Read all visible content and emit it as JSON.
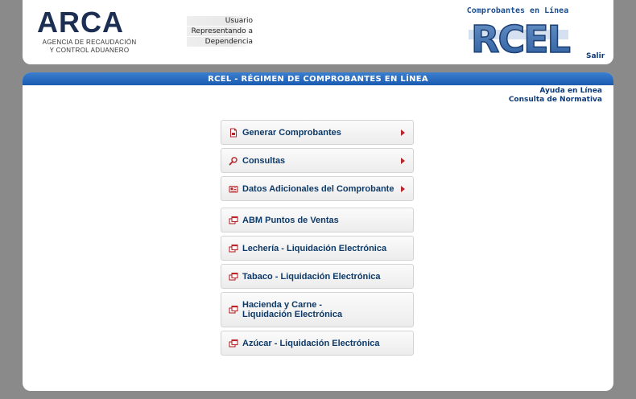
{
  "header": {
    "logo": {
      "word": "ARCA",
      "subtitle_line1": "AGENCIA DE RECAUDACIÓN",
      "subtitle_line2": "Y CONTROL ADUANERO"
    },
    "user_info": {
      "usuario_label": "Usuario",
      "representando_label": "Representando a",
      "dependencia_label": "Dependencia"
    },
    "rcel_logo": {
      "caption": "Comprobantes en Línea",
      "word": "RCEL"
    },
    "salir_label": "Salir"
  },
  "main": {
    "title": "RCEL - RÉGIMEN DE COMPROBANTES EN LÍNEA",
    "help_links": {
      "ayuda": "Ayuda en Línea",
      "normativa": "Consulta de Normativa"
    },
    "menu": [
      {
        "label": "Generar Comprobantes",
        "icon": "document-icon",
        "has_arrow": true
      },
      {
        "label": "Consultas",
        "icon": "search-icon",
        "has_arrow": true
      },
      {
        "label": "Datos Adicionales del Comprobante",
        "icon": "id-card-icon",
        "has_arrow": true
      },
      {
        "label": "ABM Puntos de Ventas",
        "icon": "external-window-icon",
        "has_arrow": false
      },
      {
        "label": "Lechería - Liquidación Electrónica",
        "icon": "external-window-icon",
        "has_arrow": false
      },
      {
        "label": "Tabaco - Liquidación Electrónica",
        "icon": "external-window-icon",
        "has_arrow": false
      },
      {
        "label": "Hacienda y Carne - Liquidación Electrónica",
        "icon": "external-window-icon",
        "has_arrow": false
      },
      {
        "label": "Azúcar - Liquidación Electrónica",
        "icon": "external-window-icon",
        "has_arrow": false
      }
    ],
    "colors": {
      "title_bar": "#1a5bb0",
      "menu_text": "#0e3a68",
      "icon_red": "#b8252a"
    }
  }
}
